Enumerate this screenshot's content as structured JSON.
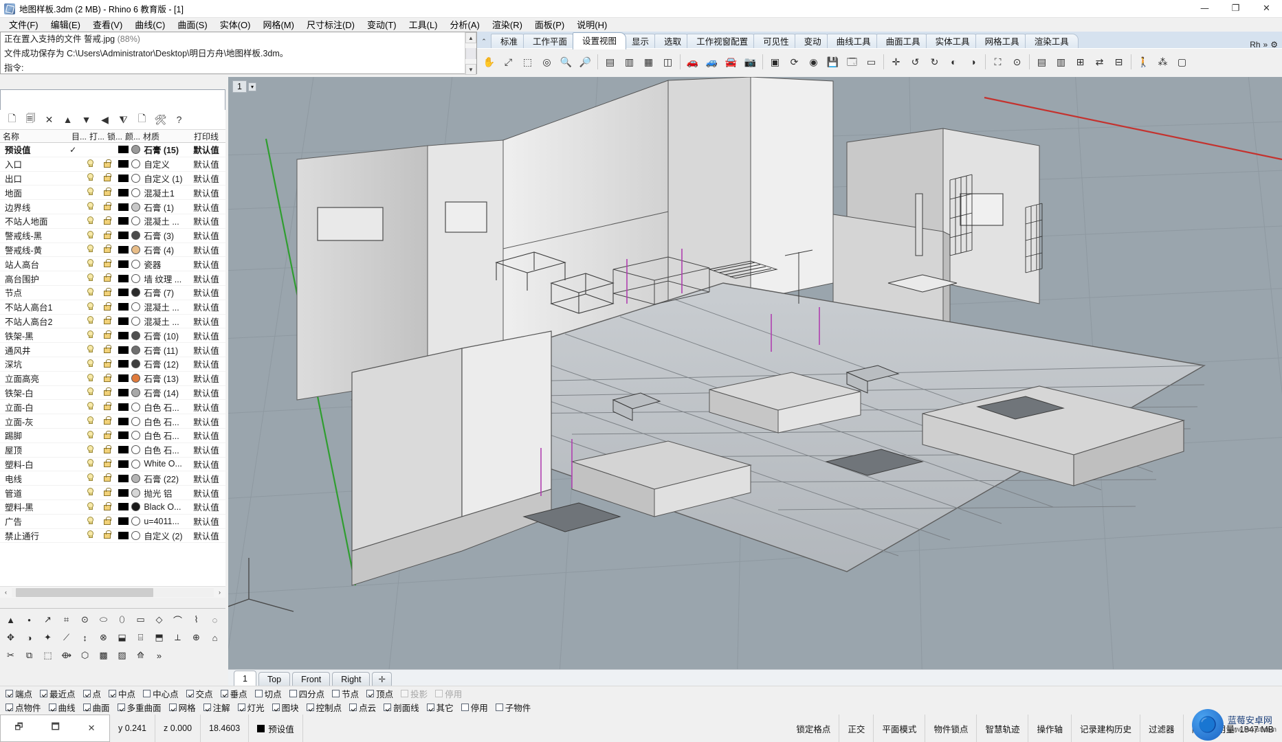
{
  "titlebar": {
    "title": "地图样板.3dm (2 MB) - Rhino 6 教育版 - [1]",
    "minimize": "—",
    "maximize": "❐",
    "close": "✕"
  },
  "menubar": {
    "items": [
      "文件(F)",
      "编辑(E)",
      "查看(V)",
      "曲线(C)",
      "曲面(S)",
      "实体(O)",
      "网格(M)",
      "尺寸标注(D)",
      "变动(T)",
      "工具(L)",
      "分析(A)",
      "渲染(R)",
      "面板(P)",
      "说明(H)"
    ]
  },
  "command": {
    "line1_main": "正在置入支持的文件 誓戒.jpg",
    "line1_dim": "(88%)",
    "line2": "文件成功保存为 C:\\Users\\Administrator\\Desktop\\明日方舟\\地图样板.3dm。",
    "prompt_label": "指令:",
    "prompt_value": ""
  },
  "toolbar_tabs": {
    "collapse_icon": "⌃",
    "items": [
      {
        "label": "标准",
        "active": false
      },
      {
        "label": "工作平面",
        "active": false
      },
      {
        "label": "设置视图",
        "active": true
      },
      {
        "label": "显示",
        "active": false
      },
      {
        "label": "选取",
        "active": false
      },
      {
        "label": "工作视窗配置",
        "active": false
      },
      {
        "label": "可见性",
        "active": false
      },
      {
        "label": "变动",
        "active": false
      },
      {
        "label": "曲线工具",
        "active": false
      },
      {
        "label": "曲面工具",
        "active": false
      },
      {
        "label": "实体工具",
        "active": false
      },
      {
        "label": "网格工具",
        "active": false
      },
      {
        "label": "渲染工具",
        "active": false
      }
    ],
    "overflow_label": "Rh",
    "overflow_chevron": "»",
    "overflow_gear": "⚙"
  },
  "toolbar_icons": [
    {
      "name": "pan-icon",
      "glyph": "✋"
    },
    {
      "name": "zoom-extents-icon",
      "glyph": "⤢"
    },
    {
      "name": "zoom-window-icon",
      "glyph": "⬚"
    },
    {
      "name": "zoom-selected-icon",
      "glyph": "◎"
    },
    {
      "name": "zoom-in-icon",
      "glyph": "🔍"
    },
    {
      "name": "zoom-out-icon",
      "glyph": "🔎"
    },
    {
      "name": "sep",
      "glyph": ""
    },
    {
      "name": "view-top-icon",
      "glyph": "▤"
    },
    {
      "name": "view-front-icon",
      "glyph": "▥"
    },
    {
      "name": "view-right-icon",
      "glyph": "▦"
    },
    {
      "name": "view-perspective-icon",
      "glyph": "◫"
    },
    {
      "name": "sep",
      "glyph": ""
    },
    {
      "name": "named-view-red-icon",
      "glyph": "🚗"
    },
    {
      "name": "named-view-save-icon",
      "glyph": "🚙"
    },
    {
      "name": "named-view-restore-icon",
      "glyph": "🚘"
    },
    {
      "name": "camera-icon",
      "glyph": "📷"
    },
    {
      "name": "sep",
      "glyph": ""
    },
    {
      "name": "set-view-icon",
      "glyph": "▣"
    },
    {
      "name": "rotate-view-icon",
      "glyph": "⟳"
    },
    {
      "name": "camera-lens-icon",
      "glyph": "◉"
    },
    {
      "name": "save-view-icon",
      "glyph": "💾"
    },
    {
      "name": "restore-view-icon",
      "glyph": "🗔"
    },
    {
      "name": "viewport-title-icon",
      "glyph": "▭"
    },
    {
      "name": "sep",
      "glyph": ""
    },
    {
      "name": "target-icon",
      "glyph": "✛"
    },
    {
      "name": "rotate-left-icon",
      "glyph": "↺"
    },
    {
      "name": "rotate-right-icon",
      "glyph": "↻"
    },
    {
      "name": "tilt-left-icon",
      "glyph": "◐"
    },
    {
      "name": "tilt-right-icon",
      "glyph": "◑"
    },
    {
      "name": "sep",
      "glyph": ""
    },
    {
      "name": "walkabout-icon",
      "glyph": "⛶"
    },
    {
      "name": "turntable-icon",
      "glyph": "⊙"
    },
    {
      "name": "sep",
      "glyph": ""
    },
    {
      "name": "split-view-h-icon",
      "glyph": "▤"
    },
    {
      "name": "split-view-v-icon",
      "glyph": "▥"
    },
    {
      "name": "max-view-icon",
      "glyph": "⊞"
    },
    {
      "name": "sync-view-icon",
      "glyph": "⇄"
    },
    {
      "name": "four-view-icon",
      "glyph": "⊟"
    },
    {
      "name": "sep",
      "glyph": ""
    },
    {
      "name": "person-scale-icon",
      "glyph": "🚶"
    },
    {
      "name": "zoom-1to1-icon",
      "glyph": "⁂"
    },
    {
      "name": "viewport-props-icon",
      "glyph": "▢"
    }
  ],
  "panel_tabs": [
    {
      "name": "layers-panel-tab",
      "glyph": "▤",
      "selected": true
    },
    {
      "name": "materials-panel-tab",
      "glyph": "◍",
      "selected": false
    },
    {
      "name": "display-panel-tab",
      "glyph": "🖵",
      "selected": false
    },
    {
      "name": "render-panel-tab",
      "glyph": "📷",
      "selected": false
    },
    {
      "name": "environment-panel-tab",
      "glyph": "◉",
      "selected": false
    },
    {
      "name": "ground-plane-panel-tab",
      "glyph": "◓",
      "selected": false
    },
    {
      "name": "eyedropper-panel-tab",
      "glyph": "🖉",
      "selected": false
    },
    {
      "name": "properties-panel-tab",
      "glyph": "▦",
      "selected": false
    }
  ],
  "layer_toolbar": [
    {
      "name": "new-layer-icon",
      "glyph": "🗋"
    },
    {
      "name": "new-sublayer-icon",
      "glyph": "🗐"
    },
    {
      "name": "delete-layer-icon",
      "glyph": "✕"
    },
    {
      "name": "move-layer-up-icon",
      "glyph": "▲"
    },
    {
      "name": "move-layer-down-icon",
      "glyph": "▼"
    },
    {
      "name": "move-layer-left-icon",
      "glyph": "◀"
    },
    {
      "name": "filter-layer-icon",
      "glyph": "⧨"
    },
    {
      "name": "layer-properties-icon",
      "glyph": "🗋"
    },
    {
      "name": "layer-tools-icon",
      "glyph": "🛠"
    },
    {
      "name": "help-icon",
      "glyph": "?"
    }
  ],
  "layer_columns": {
    "name": "名称",
    "current": "目...",
    "on": "打...",
    "lock": "锁...",
    "color": "颜...",
    "material": "材质",
    "print": "打印线"
  },
  "layers": [
    {
      "name": "预设值",
      "current": true,
      "bulb": false,
      "lock": false,
      "color": "#000000",
      "mat_color": "#9a9a9a",
      "material": "石膏 (15)",
      "print": "默认值",
      "bold": true
    },
    {
      "name": "入口",
      "current": false,
      "bulb": true,
      "lock": true,
      "color": "#000000",
      "mat_color": "#ffffff",
      "material": "自定义",
      "print": "默认值",
      "bold": false
    },
    {
      "name": "出口",
      "current": false,
      "bulb": true,
      "lock": true,
      "color": "#000000",
      "mat_color": "#ffffff",
      "material": "自定义 (1)",
      "print": "默认值",
      "bold": false
    },
    {
      "name": "地面",
      "current": false,
      "bulb": true,
      "lock": true,
      "color": "#000000",
      "mat_color": "#ffffff",
      "material": "混凝土1",
      "print": "默认值",
      "bold": false
    },
    {
      "name": "边界线",
      "current": false,
      "bulb": true,
      "lock": true,
      "color": "#000000",
      "mat_color": "#c8c8c8",
      "material": "石膏 (1)",
      "print": "默认值",
      "bold": false
    },
    {
      "name": "不站人地面",
      "current": false,
      "bulb": true,
      "lock": true,
      "color": "#000000",
      "mat_color": "#ffffff",
      "material": "混凝土 ...",
      "print": "默认值",
      "bold": false
    },
    {
      "name": "警戒线-黑",
      "current": false,
      "bulb": true,
      "lock": true,
      "color": "#000000",
      "mat_color": "#4a4a4a",
      "material": "石膏 (3)",
      "print": "默认值",
      "bold": false
    },
    {
      "name": "警戒线-黄",
      "current": false,
      "bulb": true,
      "lock": true,
      "color": "#000000",
      "mat_color": "#e8bd88",
      "material": "石膏 (4)",
      "print": "默认值",
      "bold": false
    },
    {
      "name": "站人高台",
      "current": false,
      "bulb": true,
      "lock": true,
      "color": "#000000",
      "mat_color": "#ffffff",
      "material": "瓷器",
      "print": "默认值",
      "bold": false
    },
    {
      "name": "高台围护",
      "current": false,
      "bulb": true,
      "lock": true,
      "color": "#000000",
      "mat_color": "#ffffff",
      "material": "墙 纹理 ...",
      "print": "默认值",
      "bold": false
    },
    {
      "name": "节点",
      "current": false,
      "bulb": true,
      "lock": true,
      "color": "#000000",
      "mat_color": "#2a2a2a",
      "material": "石膏 (7)",
      "print": "默认值",
      "bold": false
    },
    {
      "name": "不站人高台1",
      "current": false,
      "bulb": true,
      "lock": true,
      "color": "#000000",
      "mat_color": "#ffffff",
      "material": "混凝土 ...",
      "print": "默认值",
      "bold": false
    },
    {
      "name": "不站人高台2",
      "current": false,
      "bulb": true,
      "lock": true,
      "color": "#000000",
      "mat_color": "#ffffff",
      "material": "混凝土 ...",
      "print": "默认值",
      "bold": false
    },
    {
      "name": "铁架-黑",
      "current": false,
      "bulb": true,
      "lock": true,
      "color": "#000000",
      "mat_color": "#4e4e4e",
      "material": "石膏 (10)",
      "print": "默认值",
      "bold": false
    },
    {
      "name": "通风井",
      "current": false,
      "bulb": true,
      "lock": true,
      "color": "#000000",
      "mat_color": "#6f6f6f",
      "material": "石膏 (11)",
      "print": "默认值",
      "bold": false
    },
    {
      "name": "深坑",
      "current": false,
      "bulb": true,
      "lock": true,
      "color": "#000000",
      "mat_color": "#3d3d3d",
      "material": "石膏 (12)",
      "print": "默认值",
      "bold": false
    },
    {
      "name": "立面高亮",
      "current": false,
      "bulb": true,
      "lock": true,
      "color": "#000000",
      "mat_color": "#e07b3c",
      "material": "石膏 (13)",
      "print": "默认值",
      "bold": false
    },
    {
      "name": "铁架-白",
      "current": false,
      "bulb": true,
      "lock": true,
      "color": "#000000",
      "mat_color": "#a8a8a8",
      "material": "石膏 (14)",
      "print": "默认值",
      "bold": false
    },
    {
      "name": "立面-白",
      "current": false,
      "bulb": true,
      "lock": true,
      "color": "#000000",
      "mat_color": "#ffffff",
      "material": "白色 石...",
      "print": "默认值",
      "bold": false
    },
    {
      "name": "立面-灰",
      "current": false,
      "bulb": true,
      "lock": true,
      "color": "#000000",
      "mat_color": "#ffffff",
      "material": "白色 石...",
      "print": "默认值",
      "bold": false
    },
    {
      "name": "踢脚",
      "current": false,
      "bulb": true,
      "lock": true,
      "color": "#000000",
      "mat_color": "#ffffff",
      "material": "白色 石...",
      "print": "默认值",
      "bold": false
    },
    {
      "name": "屋顶",
      "current": false,
      "bulb": true,
      "lock": true,
      "color": "#000000",
      "mat_color": "#ffffff",
      "material": "白色 石...",
      "print": "默认值",
      "bold": false
    },
    {
      "name": "塑料-白",
      "current": false,
      "bulb": true,
      "lock": true,
      "color": "#000000",
      "mat_color": "#ffffff",
      "material": "White O...",
      "print": "默认值",
      "bold": false
    },
    {
      "name": "电线",
      "current": false,
      "bulb": true,
      "lock": true,
      "color": "#000000",
      "mat_color": "#b4b4b4",
      "material": "石膏 (22)",
      "print": "默认值",
      "bold": false
    },
    {
      "name": "管道",
      "current": false,
      "bulb": true,
      "lock": true,
      "color": "#000000",
      "mat_color": "#d6d6d6",
      "material": "抛光 铝",
      "print": "默认值",
      "bold": false
    },
    {
      "name": "塑料-黑",
      "current": false,
      "bulb": true,
      "lock": true,
      "color": "#000000",
      "mat_color": "#1a1a1a",
      "material": "Black O...",
      "print": "默认值",
      "bold": false
    },
    {
      "name": "广告",
      "current": false,
      "bulb": true,
      "lock": true,
      "color": "#000000",
      "mat_color": "#ffffff",
      "material": "u=4011...",
      "print": "默认值",
      "bold": false
    },
    {
      "name": "禁止通行",
      "current": false,
      "bulb": true,
      "lock": true,
      "color": "#000000",
      "mat_color": "#ffffff",
      "material": "自定义 (2)",
      "print": "默认值",
      "bold": false
    }
  ],
  "palette_icons": [
    "▲",
    "•",
    "↗",
    "⌗",
    "⊙",
    "⬭",
    "⬯",
    "▭",
    "◇",
    "⌒",
    "⌇",
    "◌",
    "✥",
    "◑",
    "✦",
    "⟋",
    "↕",
    "⊗",
    "⬓",
    "⌸",
    "⬒",
    "⟂",
    "⊕",
    "⌂",
    "✂",
    "⧉",
    "⬚",
    "⟴",
    "⬡",
    "▩",
    "▨",
    "⟰",
    "»"
  ],
  "viewport": {
    "label_number": "1",
    "label_arrow": "▾",
    "tabs": [
      {
        "label": "1",
        "active": true
      },
      {
        "label": "Top",
        "active": false
      },
      {
        "label": "Front",
        "active": false
      },
      {
        "label": "Right",
        "active": false
      }
    ],
    "add_tab": "✛"
  },
  "osnap_row1": [
    {
      "label": "端点",
      "checked": true,
      "disabled": false
    },
    {
      "label": "最近点",
      "checked": true,
      "disabled": false
    },
    {
      "label": "点",
      "checked": true,
      "disabled": false
    },
    {
      "label": "中点",
      "checked": true,
      "disabled": false
    },
    {
      "label": "中心点",
      "checked": false,
      "disabled": false
    },
    {
      "label": "交点",
      "checked": true,
      "disabled": false
    },
    {
      "label": "垂点",
      "checked": true,
      "disabled": false
    },
    {
      "label": "切点",
      "checked": false,
      "disabled": false
    },
    {
      "label": "四分点",
      "checked": false,
      "disabled": false
    },
    {
      "label": "节点",
      "checked": false,
      "disabled": false
    },
    {
      "label": "顶点",
      "checked": true,
      "disabled": false
    },
    {
      "label": "投影",
      "checked": false,
      "disabled": true
    },
    {
      "label": "停用",
      "checked": false,
      "disabled": true
    }
  ],
  "osnap_row2": [
    {
      "label": "点物件",
      "checked": true,
      "disabled": false
    },
    {
      "label": "曲线",
      "checked": true,
      "disabled": false
    },
    {
      "label": "曲面",
      "checked": true,
      "disabled": false
    },
    {
      "label": "多重曲面",
      "checked": true,
      "disabled": false
    },
    {
      "label": "网格",
      "checked": true,
      "disabled": false
    },
    {
      "label": "注解",
      "checked": true,
      "disabled": false
    },
    {
      "label": "灯光",
      "checked": true,
      "disabled": false
    },
    {
      "label": "图块",
      "checked": true,
      "disabled": false
    },
    {
      "label": "控制点",
      "checked": true,
      "disabled": false
    },
    {
      "label": "点云",
      "checked": true,
      "disabled": false
    },
    {
      "label": "剖面线",
      "checked": true,
      "disabled": false
    },
    {
      "label": "其它",
      "checked": true,
      "disabled": false
    },
    {
      "label": "停用",
      "checked": false,
      "disabled": false
    },
    {
      "label": "子物件",
      "checked": false,
      "disabled": false
    }
  ],
  "statusbar": {
    "win_icons": [
      "🗗",
      "🗖",
      "✕"
    ],
    "coord_y": "y 0.241",
    "coord_z": "z 0.000",
    "value": "18.4603",
    "layer": "预设值",
    "toggles": [
      "锁定格点",
      "正交",
      "平面模式",
      "物件锁点",
      "智慧轨迹",
      "操作轴",
      "记录建构历史",
      "过滤器"
    ],
    "memory": "内存使用量: 1847 MB"
  },
  "watermark": {
    "icon": "🔵",
    "line1": "蓝莓安卓网",
    "line2": "www.lmkjst.com"
  },
  "colors": {
    "accent": "#2b6cb0",
    "viewport_bg": "#9aa5ad",
    "panel_bg": "#f0f0f0",
    "axis_x": "#c4322e",
    "axis_y": "#3a9e3a"
  }
}
